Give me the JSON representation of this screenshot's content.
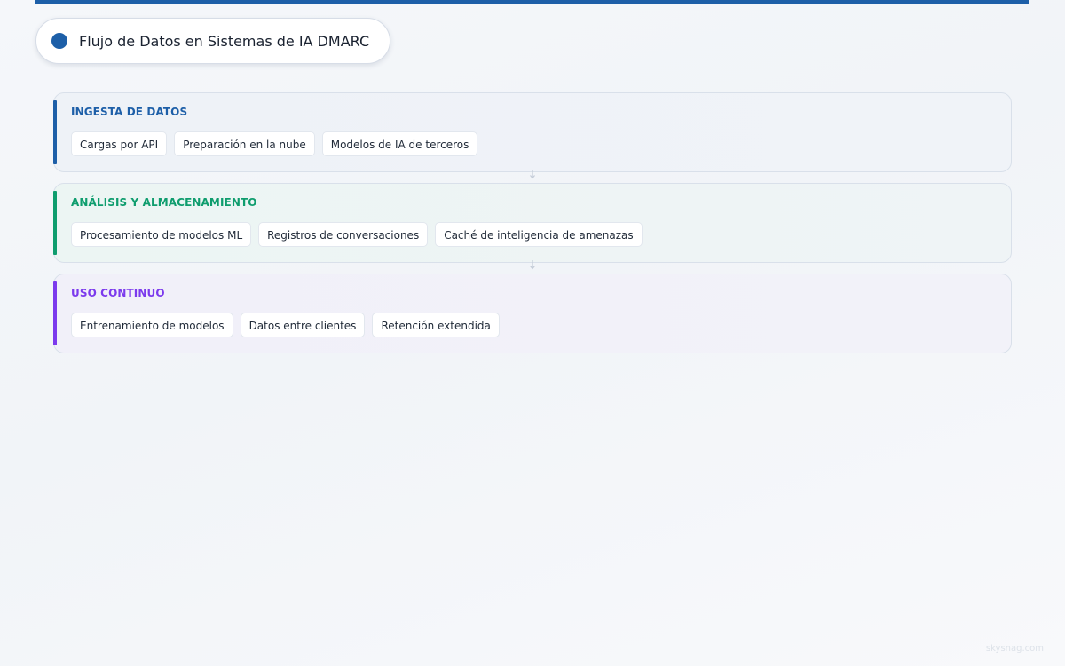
{
  "title": "Flujo de Datos en Sistemas de IA DMARC",
  "colors": {
    "brand": "#1d5fa8",
    "ingesta": "#1d5fa8",
    "analisis": "#0f9d6e",
    "uso": "#7c3aed"
  },
  "stages": [
    {
      "title": "INGESTA DE DATOS",
      "items": [
        "Cargas por API",
        "Preparación en la nube",
        "Modelos de IA de terceros"
      ]
    },
    {
      "title": "ANÁLISIS Y ALMACENAMIENTO",
      "items": [
        "Procesamiento de modelos ML",
        "Registros de conversaciones",
        "Caché de inteligencia de amenazas"
      ]
    },
    {
      "title": "USO CONTINUO",
      "items": [
        "Entrenamiento de modelos",
        "Datos entre clientes",
        "Retención extendida"
      ]
    }
  ],
  "watermark": "skysnag.com"
}
